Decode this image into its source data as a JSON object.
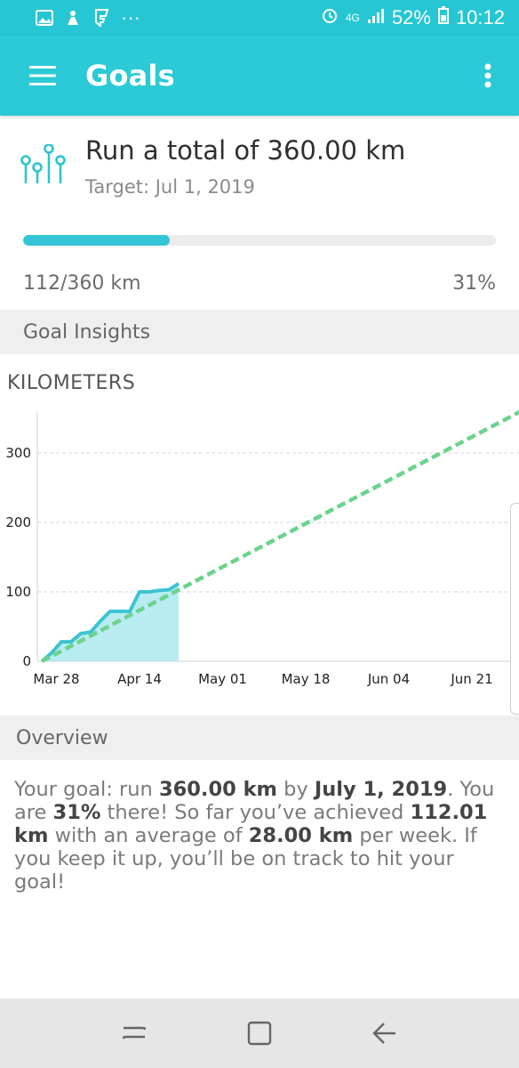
{
  "status_bar": {
    "network": "4G",
    "battery": "52%",
    "time": "10:12",
    "dots": "···"
  },
  "app_bar": {
    "title": "Goals"
  },
  "goal": {
    "title": "Run a total of 360.00 km",
    "target": "Target: Jul 1, 2019",
    "progress_text": "112/360 km",
    "percent_text": "31%",
    "progress_fraction": 0.31
  },
  "sections": {
    "insights": "Goal Insights",
    "overview": "Overview"
  },
  "chart_data": {
    "type": "line",
    "ylabel": "KILOMETERS",
    "ylim": [
      0,
      350
    ],
    "yticks": [
      "0",
      "100",
      "200",
      "300"
    ],
    "xticks": [
      "Mar 28",
      "Apr 14",
      "May 01",
      "May 18",
      "Jun 04",
      "Jun 21"
    ],
    "grid": true,
    "series": [
      {
        "kind": "actual",
        "color": "#3cc4d2",
        "fill": "#b9ecf1",
        "x": [
          "Mar 25",
          "Mar 27",
          "Mar 29",
          "Mar 31",
          "Apr 2",
          "Apr 4",
          "Apr 6",
          "Apr 8",
          "Apr 10",
          "Apr 12",
          "Apr 14",
          "Apr 16",
          "Apr 18",
          "Apr 20",
          "Apr 22"
        ],
        "y": [
          0,
          12,
          28,
          28,
          40,
          42,
          58,
          72,
          72,
          72,
          100,
          100,
          102,
          103,
          112
        ]
      },
      {
        "kind": "target",
        "color": "#6bd38d",
        "style": "dashed",
        "x": [
          "Mar 25",
          "Jul 1"
        ],
        "y": [
          0,
          360
        ]
      }
    ]
  },
  "overview": {
    "p1": "Your goal: run ",
    "goal_km": "360.00 km",
    "p2": " by ",
    "goal_date": "July 1, 2019",
    "p3": ". You are ",
    "pct": "31%",
    "p4": " there! So far you’ve achieved ",
    "achieved": "112.01 km",
    "p5": " with an average of ",
    "avg": "28.00 km",
    "p6": " per week. If you keep it up, you’ll be on track to hit your goal!"
  }
}
